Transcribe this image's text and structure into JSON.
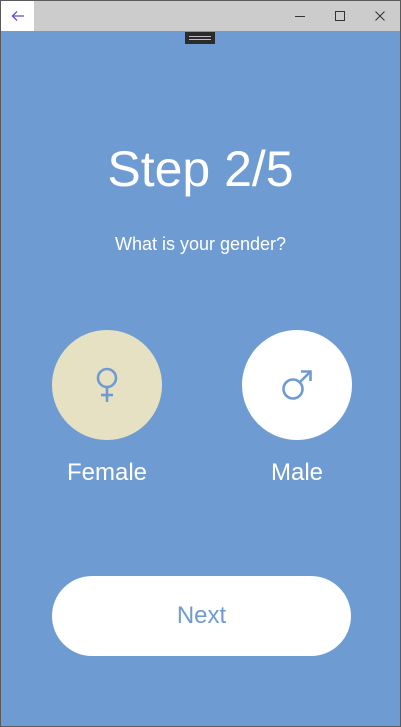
{
  "titlebar": {
    "back_icon": "arrow-left-icon",
    "controls": [
      "minimize-icon",
      "maximize-icon",
      "close-icon"
    ]
  },
  "header": {
    "step": "Step 2/5",
    "question": "What is your gender?"
  },
  "options": [
    {
      "label": "Female",
      "icon": "female-symbol-icon",
      "selected": true
    },
    {
      "label": "Male",
      "icon": "male-symbol-icon",
      "selected": false
    }
  ],
  "next_label": "Next",
  "colors": {
    "background": "#6f9bd3",
    "selected_circle": "#e6e1c3",
    "unselected_circle": "#ffffff",
    "icon": "#6f9bd3",
    "titlebar": "#cccccc"
  }
}
